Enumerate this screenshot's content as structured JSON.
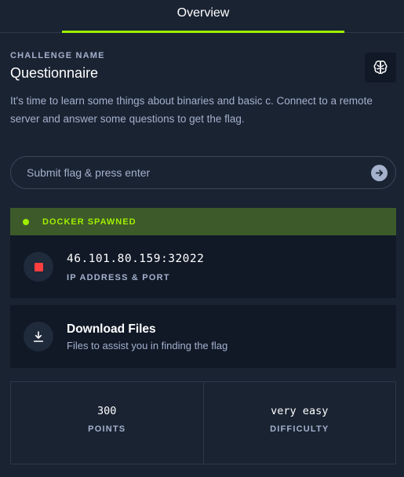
{
  "tabs": [
    {
      "label": "Overview",
      "active": true
    }
  ],
  "challenge": {
    "name_label": "CHALLENGE NAME",
    "name": "Questionnaire",
    "os_icon": "brain-icon",
    "description": "It's time to learn some things about binaries and basic c. Connect to a remote server and answer some questions to get the flag."
  },
  "flag_input": {
    "placeholder": "Submit flag & press enter",
    "value": "",
    "submit_icon": "arrow-right-icon"
  },
  "docker": {
    "status": "DOCKER SPAWNED",
    "status_color": "#9fef00"
  },
  "instance": {
    "address": "46.101.80.159:32022",
    "label": "IP ADDRESS & PORT",
    "stop_icon": "stop-icon",
    "stop_color": "#ff3e3e"
  },
  "download": {
    "title": "Download Files",
    "subtitle": "Files to assist you in finding the flag",
    "icon": "download-icon"
  },
  "stats": [
    {
      "value": "300",
      "label": "POINTS"
    },
    {
      "value": "very easy",
      "label": "DIFFICULTY"
    }
  ],
  "colors": {
    "background": "#1a2332",
    "panel": "#111927",
    "accent": "#9fef00",
    "muted": "#a4b1cd"
  }
}
